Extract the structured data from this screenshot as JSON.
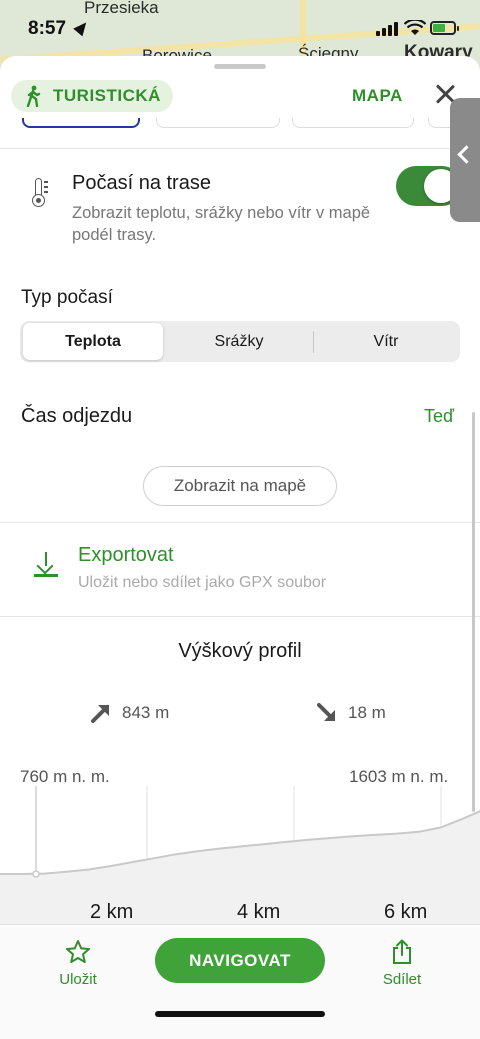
{
  "status_bar": {
    "time": "8:57"
  },
  "map": {
    "labels": [
      "Przesieka",
      "Borowice",
      "Ściegny",
      "Kowary"
    ]
  },
  "header": {
    "mode_label": "TURISTICKÁ",
    "map_label": "MAPA"
  },
  "weather": {
    "title": "Počasí na trase",
    "description": "Zobrazit teplotu, srážky nebo vítr v mapě podél trasy.",
    "enabled": true,
    "type_label": "Typ počasí",
    "types": [
      "Teplota",
      "Srážky",
      "Vítr"
    ],
    "selected_type": "Teplota",
    "departure_label": "Čas odjezdu",
    "departure_value": "Teď",
    "show_on_map": "Zobrazit na mapě"
  },
  "export": {
    "title": "Exportovat",
    "description": "Uložit nebo sdílet jako GPX soubor"
  },
  "elevation": {
    "title": "Výškový profil",
    "ascent": "843 m",
    "descent": "18 m",
    "min": "760 m n. m.",
    "max": "1603 m n. m.",
    "km_labels": [
      "2 km",
      "4 km",
      "6 km"
    ],
    "profile_points_m": [
      [
        0,
        760
      ],
      [
        0.3,
        760
      ],
      [
        0.6,
        765
      ],
      [
        0.9,
        785
      ],
      [
        1.2,
        810
      ],
      [
        1.5,
        850
      ],
      [
        1.8,
        895
      ],
      [
        2.1,
        940
      ],
      [
        2.4,
        985
      ],
      [
        2.7,
        1020
      ],
      [
        3.0,
        1050
      ],
      [
        3.3,
        1075
      ],
      [
        3.6,
        1100
      ],
      [
        3.9,
        1125
      ],
      [
        4.2,
        1150
      ],
      [
        4.5,
        1170
      ],
      [
        4.8,
        1190
      ],
      [
        5.1,
        1205
      ],
      [
        5.4,
        1220
      ],
      [
        5.7,
        1240
      ],
      [
        6.0,
        1290
      ],
      [
        6.3,
        1390
      ],
      [
        6.6,
        1500
      ],
      [
        6.75,
        1603
      ]
    ]
  },
  "bottom_bar": {
    "save_label": "Uložit",
    "navigate_label": "NAVIGOVAT",
    "share_label": "Sdílet"
  },
  "colors": {
    "accent_green": "#2f8f2b",
    "button_green": "#3fa33a",
    "toggle_green": "#3a8a3a"
  }
}
